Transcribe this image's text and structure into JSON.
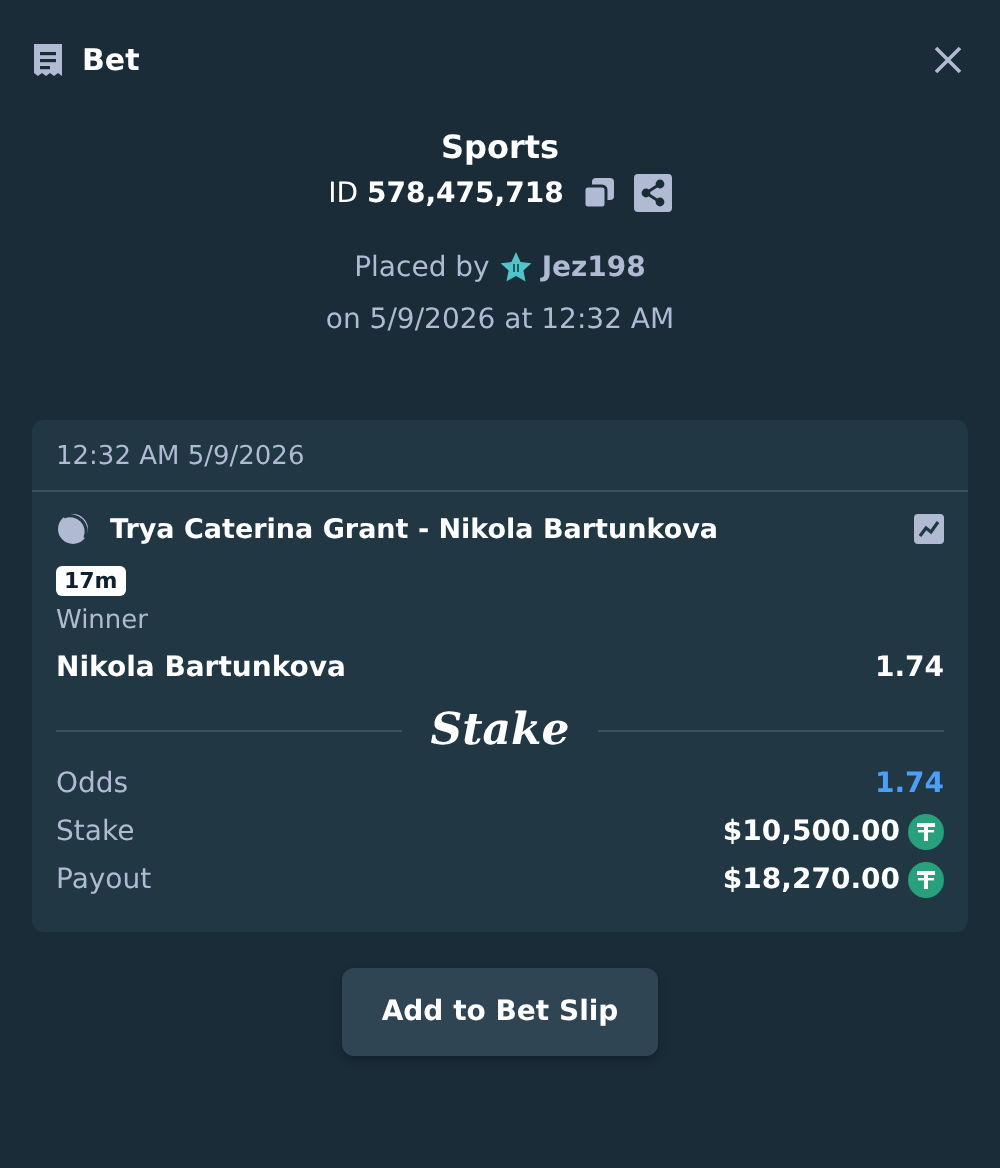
{
  "header": {
    "title": "Bet"
  },
  "summary": {
    "category": "Sports",
    "id_label": "ID",
    "id_value": "578,475,718",
    "placed_by": "Placed by",
    "user": "Jez198",
    "placed_on": "on 5/9/2026 at 12:32 AM"
  },
  "bet_card": {
    "timestamp": "12:32 AM 5/9/2026",
    "event": "Trya Caterina Grant - Nikola Bartunkova",
    "badge": "17m",
    "market": "Winner",
    "selection": "Nikola Bartunkova",
    "selection_odds": "1.74",
    "logo": "Stake",
    "rows": [
      {
        "label": "Odds",
        "value": "1.74",
        "kind": "odds"
      },
      {
        "label": "Stake",
        "value": "$10,500.00",
        "kind": "amount"
      },
      {
        "label": "Payout",
        "value": "$18,270.00",
        "kind": "amount"
      }
    ]
  },
  "button": "Add to Bet Slip"
}
